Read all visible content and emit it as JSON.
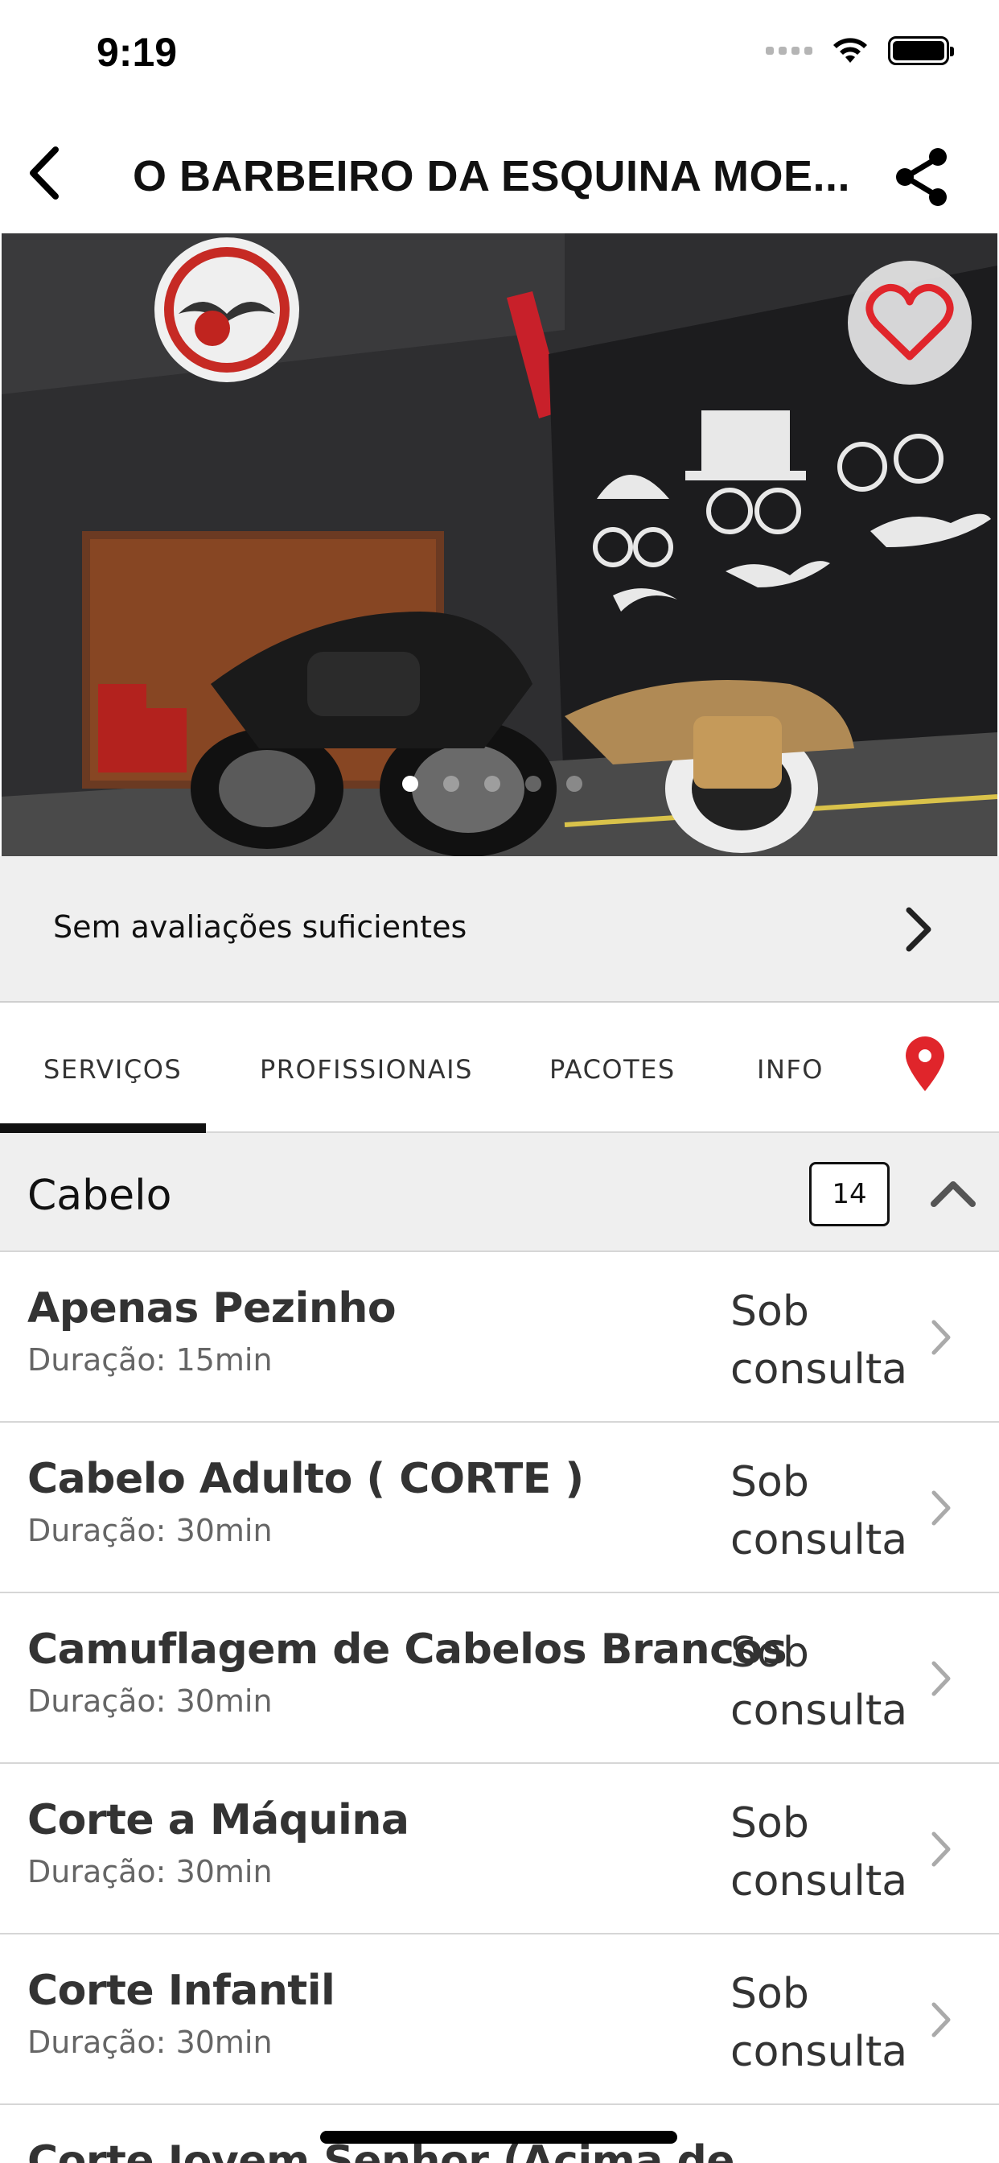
{
  "status": {
    "time": "9:19"
  },
  "nav": {
    "title": "O BARBEIRO DA ESQUINA MOE..."
  },
  "hero": {
    "image_alt": "Barbershop storefront",
    "slides_total": 5,
    "active_slide": 1
  },
  "rating": {
    "text": "Sem avaliações suficientes"
  },
  "tabs": [
    {
      "label": "SERVIÇOS",
      "active": true
    },
    {
      "label": "PROFISSIONAIS",
      "active": false
    },
    {
      "label": "PACOTES",
      "active": false
    },
    {
      "label": "INFO",
      "active": false
    }
  ],
  "category": {
    "title": "Cabelo",
    "count": "14"
  },
  "services": [
    {
      "name": "Apenas Pezinho",
      "duration": "Duração: 15min",
      "price_line1": "Sob",
      "price_line2": "consulta"
    },
    {
      "name": "Cabelo Adulto ( CORTE )",
      "duration": "Duração: 30min",
      "price_line1": "Sob",
      "price_line2": "consulta"
    },
    {
      "name": "Camuflagem de Cabelos Brancos",
      "duration": "Duração: 30min",
      "price_line1": "Sob",
      "price_line2": "consulta"
    },
    {
      "name": "Corte a Máquina",
      "duration": "Duração: 30min",
      "price_line1": "Sob",
      "price_line2": "consulta"
    },
    {
      "name": "Corte Infantil",
      "duration": "Duração: 30min",
      "price_line1": "Sob",
      "price_line2": "consulta"
    },
    {
      "name": "Corte Jovem Senhor (Acima de"
    }
  ],
  "colors": {
    "accent_red": "#e0252b",
    "separator": "#d6d6d6",
    "panel_gray": "#efefef"
  }
}
